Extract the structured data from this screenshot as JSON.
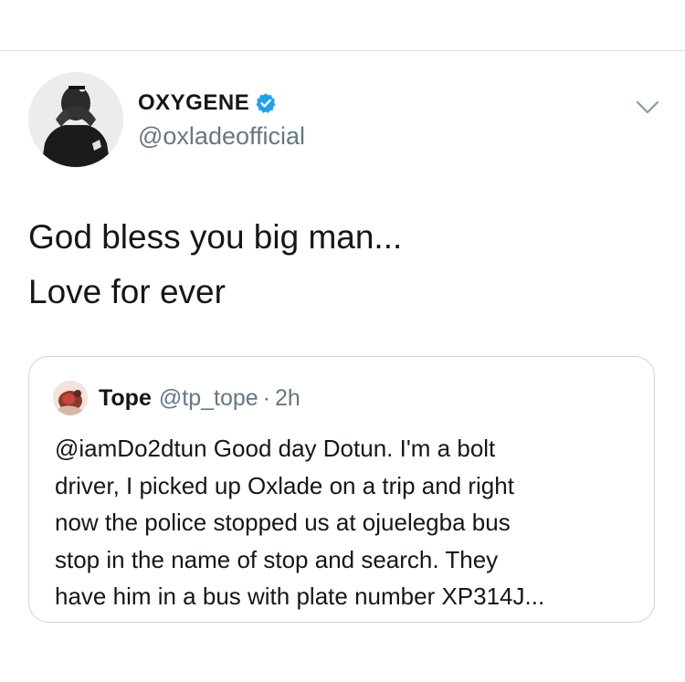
{
  "tweet": {
    "author": {
      "display_name": "OXYGENE",
      "handle": "@oxladeofficial",
      "verified": true,
      "avatar_icon": "profile-photo"
    },
    "menu_icon": "chevron-down-icon",
    "text_lines": [
      "God bless you big man...",
      "Love for ever"
    ]
  },
  "quoted_tweet": {
    "author": {
      "display_name": "Tope",
      "handle": "@tp_tope",
      "separator": "·",
      "time": "2h"
    },
    "text_lines": [
      "@iamDo2dtun Good day Dotun. I'm a bolt",
      "driver, I picked up Oxlade on a trip and right",
      "now the police stopped us at ojuelegba bus",
      "stop in the name of stop and search. They",
      "have him in a bus with plate number XP314J..."
    ]
  },
  "colors": {
    "text_primary": "#14171a",
    "text_secondary": "#657786",
    "verified_blue": "#1da1f2",
    "border": "#cdd3d9"
  }
}
